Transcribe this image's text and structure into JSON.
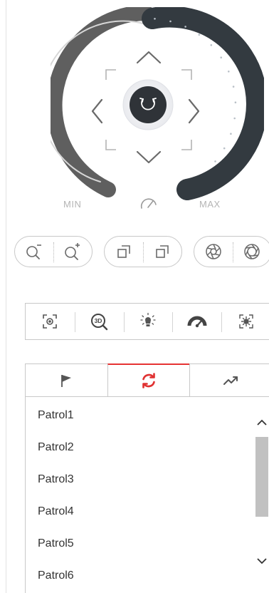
{
  "ptz": {
    "speed_min_label": "MIN",
    "speed_max_label": "MAX",
    "icons": {
      "up": "chevron-up-icon",
      "down": "chevron-down-icon",
      "left": "chevron-left-icon",
      "right": "chevron-right-icon",
      "center": "auto-pan-icon",
      "speed": "speedometer-icon"
    }
  },
  "pill_groups": [
    {
      "name": "zoom",
      "buttons": [
        "zoom-out-icon",
        "zoom-in-icon"
      ]
    },
    {
      "name": "focus",
      "buttons": [
        "focus-near-icon",
        "focus-far-icon"
      ]
    },
    {
      "name": "iris",
      "buttons": [
        "iris-close-icon",
        "iris-open-icon"
      ]
    }
  ],
  "function_bar": [
    "regional-focus-icon",
    "3d-positioning-icon",
    "light-icon",
    "wiper-icon",
    "manual-tracking-icon"
  ],
  "tabs": [
    {
      "icon": "preset-flag-icon",
      "active": false
    },
    {
      "icon": "patrol-refresh-icon",
      "active": true
    },
    {
      "icon": "pattern-trend-icon",
      "active": false
    }
  ],
  "patrol_list": [
    {
      "label": "Patrol1"
    },
    {
      "label": "Patrol2"
    },
    {
      "label": "Patrol3"
    },
    {
      "label": "Patrol4"
    },
    {
      "label": "Patrol5"
    },
    {
      "label": "Patrol6"
    }
  ],
  "colors": {
    "dial_dark": "#333a40",
    "dial_gray": "#5f5f5f",
    "active_tab": "#e63333",
    "refresh_icon": "#e03131",
    "icon_gray": "#6a6a6a"
  }
}
